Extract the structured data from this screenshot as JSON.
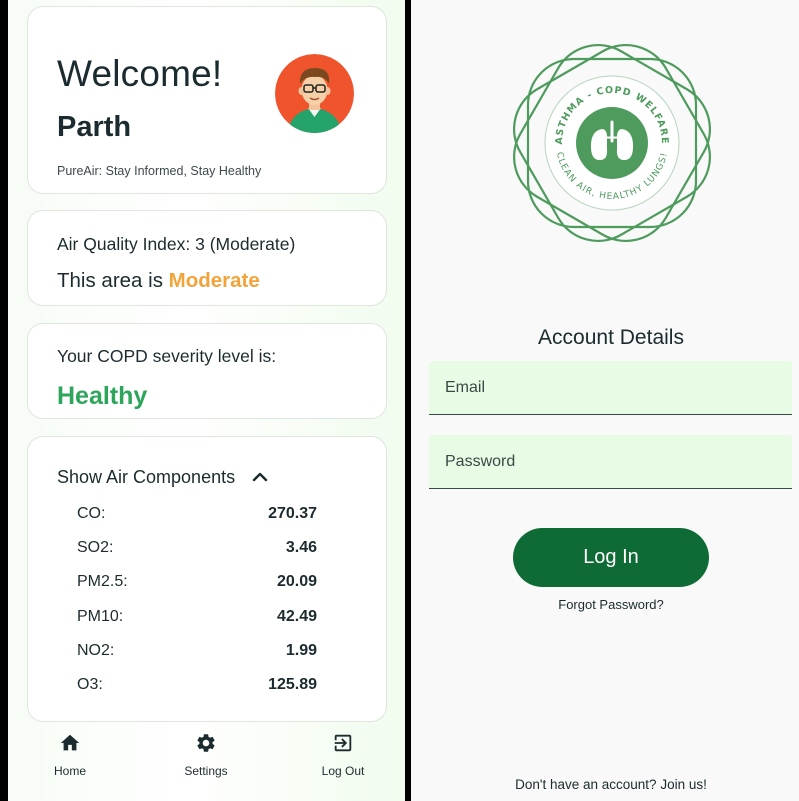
{
  "home": {
    "welcome": {
      "greeting": "Welcome!",
      "user_name": "Parth",
      "tagline": "PureAir: Stay Informed, Stay Healthy",
      "avatar_icon": "user-avatar-icon"
    },
    "air_quality": {
      "index_text": "Air Quality Index: 3 (Moderate)",
      "area_prefix": "This area is ",
      "area_status": "Moderate",
      "status_color": "#f2a33a"
    },
    "copd": {
      "label": "Your COPD severity level is:",
      "level": "Healthy",
      "level_color": "#2da55a"
    },
    "components": {
      "toggle_label": "Show Air Components",
      "toggle_icon": "chevron-up-icon",
      "items": [
        {
          "name": "CO:",
          "value": "270.37"
        },
        {
          "name": "SO2:",
          "value": "3.46"
        },
        {
          "name": "PM2.5:",
          "value": "20.09"
        },
        {
          "name": "PM10:",
          "value": "42.49"
        },
        {
          "name": "NO2:",
          "value": "1.99"
        },
        {
          "name": "O3:",
          "value": "125.89"
        }
      ]
    },
    "nav": {
      "items": [
        {
          "label": "Home",
          "icon": "home-icon"
        },
        {
          "label": "Settings",
          "icon": "gear-icon"
        },
        {
          "label": "Log Out",
          "icon": "logout-icon"
        }
      ]
    }
  },
  "login": {
    "logo": {
      "arc_text_top": "ASTHMA - COPD WELFARE",
      "arc_text_bottom": "CLEAN AIR, HEALTHY LUNGS!",
      "brand_color": "#4e9b5d"
    },
    "title": "Account Details",
    "email_placeholder": "Email",
    "password_placeholder": "Password",
    "login_label": "Log In",
    "forgot_label": "Forgot Password?",
    "signup_text": "Don't have an account? Join us!",
    "primary_color": "#0f6b35"
  }
}
